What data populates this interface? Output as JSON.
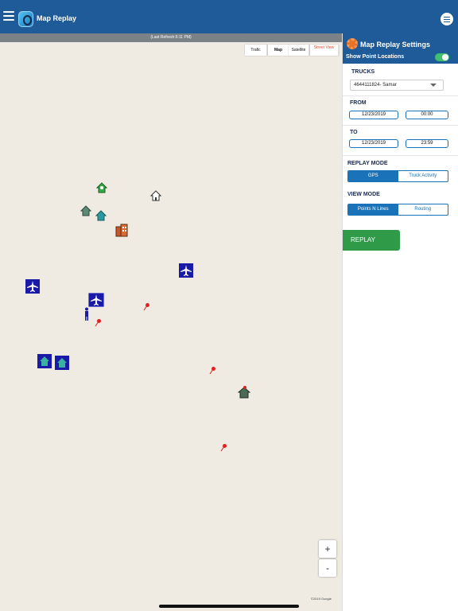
{
  "app": {
    "title": "Map Replay"
  },
  "map": {
    "last_refresh": "(Last Refresh:6:11 PM)",
    "map_types": {
      "traffic": "Trafic",
      "map": "Map",
      "satellite": "Satellite",
      "street_view": "Street View"
    },
    "zoom_in": "+",
    "zoom_out": "-",
    "copyright": "©2019 Google"
  },
  "panel": {
    "title": "Map Replay Settings",
    "show_points_label": "Show Point Locations",
    "show_points_on": true,
    "trucks_label": "TRUCKS",
    "truck_selected": "4644111824- Samar",
    "from_label": "FROM",
    "from_date": "12/23/2019",
    "from_time": "00:00",
    "to_label": "TO",
    "to_date": "12/23/2019",
    "to_time": "23:59",
    "replay_mode_label": "REPLAY MODE",
    "replay_modes": [
      "GPS",
      "Truck Activity"
    ],
    "replay_mode_selected": "GPS",
    "view_mode_label": "VIEW MODE",
    "view_modes": [
      "Points N Lines",
      "Routing"
    ],
    "view_mode_selected": "Points N Lines",
    "replay_button": "REPLAY"
  },
  "colors": {
    "header": "#1f5a99",
    "accent": "#1a73b8",
    "replay": "#2f9a48",
    "toggle_on": "#3fc06b",
    "map_bg": "#efebe3"
  }
}
